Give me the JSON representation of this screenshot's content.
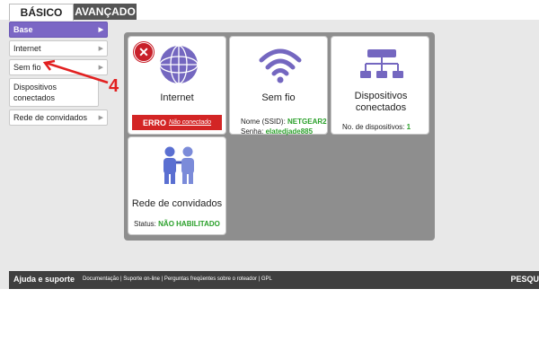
{
  "tabs": {
    "basic": "BÁSICO",
    "advanced": "AVANÇADO"
  },
  "sidebar": {
    "items": [
      {
        "label": "Base"
      },
      {
        "label": "Internet"
      },
      {
        "label": "Sem fio"
      },
      {
        "label": "Dispositivos conectados"
      },
      {
        "label": "Rede de convidados"
      }
    ]
  },
  "annotation": {
    "label": "4",
    "color": "#e22020"
  },
  "tiles": {
    "internet": {
      "title": "Internet",
      "error_label": "ERRO",
      "error_detail": "Não conectado"
    },
    "wireless": {
      "title": "Sem fio",
      "ssid_label": "Nome (SSID):",
      "ssid_value": "NETGEAR2",
      "password_label": "Senha:",
      "password_value": "elatedjade885"
    },
    "devices": {
      "title": "Dispositivos conectados",
      "count_label": "No. de dispositivos:",
      "count_value": "1"
    },
    "guest": {
      "title": "Rede de convidados",
      "status_label": "Status:",
      "status_value": "NÃO HABILITADO"
    }
  },
  "footer": {
    "title": "Ajuda e suporte",
    "links": [
      "Documentação",
      "Suporte on-line",
      "Perguntas freqüentes sobre o roteador",
      "GPL"
    ],
    "search": "PESQU"
  },
  "colors": {
    "accent": "#7b67c5",
    "error": "#d32525",
    "ok": "#2aa02a"
  }
}
